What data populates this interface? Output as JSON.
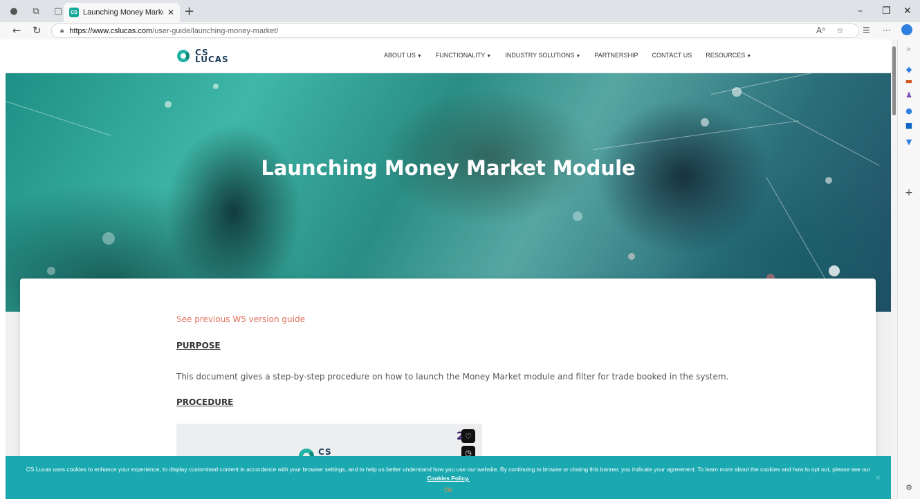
{
  "browser": {
    "tab_title": "Launching Money Market Module",
    "tab_favicon": "CS\nLU",
    "url_host": "https://www.cslucas.com",
    "url_path": "/user-guide/launching-money-market/"
  },
  "site": {
    "logo_line1": "CS",
    "logo_line2": "LUCAS",
    "nav": [
      {
        "label": "ABOUT US",
        "dropdown": true
      },
      {
        "label": "FUNCTIONALITY",
        "dropdown": true
      },
      {
        "label": "INDUSTRY SOLUTIONS",
        "dropdown": true
      },
      {
        "label": "PARTNERSHIP",
        "dropdown": false
      },
      {
        "label": "CONTACT US",
        "dropdown": false
      },
      {
        "label": "RESOURCES",
        "dropdown": true
      }
    ]
  },
  "hero": {
    "title": "Launching Money Market Module"
  },
  "content": {
    "prev_link": "See previous W5 version guide",
    "purpose_heading": "PURPOSE",
    "purpose_text": "This document gives a step-by-step procedure on how to launch the Money Market module and filter for trade booked in the system.",
    "procedure_heading": "PROCEDURE",
    "preview_logo": "CS",
    "preview_number": "2"
  },
  "cookie": {
    "message": "CS Lucas uses cookies to enhance your experience, to display customised content in accordance with your browser settings, and to help us better understand how you use our website. By continuing to browse or closing this banner, you indicate your agreement. To learn more about the cookies and how to opt out, please see our",
    "policy_link": "Cookies Policy.",
    "ok_label": "Ok",
    "close_label": "×"
  },
  "colors": {
    "accent": "#21b3a3",
    "link": "#e0705e",
    "banner": "#1aa9b1",
    "ok": "#ff8a3d"
  }
}
